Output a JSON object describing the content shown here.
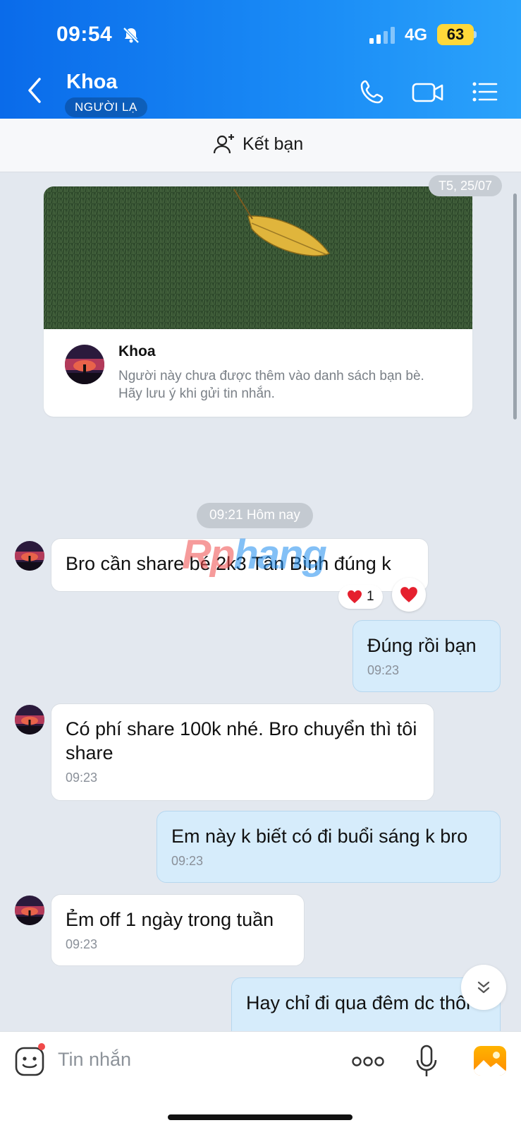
{
  "status_bar": {
    "time": "09:54",
    "network": "4G",
    "battery": "63"
  },
  "header": {
    "contact_name": "Khoa",
    "tag": "NGƯỜI LẠ"
  },
  "add_friend": {
    "label": "Kết bạn"
  },
  "chat": {
    "date_label": "T5, 25/07",
    "profile_card": {
      "name": "Khoa",
      "notice": "Người này chưa được thêm vào danh sách bạn bè. Hãy lưu ý khi gửi tin nhắn."
    },
    "time_divider": "09:21 Hôm nay",
    "watermark": {
      "part1": "Rp",
      "part2": "hang"
    },
    "messages": [
      {
        "dir": "in",
        "text": "Bro cần share bé 2k3 Tân Bình đúng k",
        "time": "",
        "reaction_count": "1"
      },
      {
        "dir": "out",
        "text": "Đúng rồi bạn",
        "time": "09:23"
      },
      {
        "dir": "in",
        "text": "Có phí share 100k nhé. Bro chuyển thì tôi share",
        "time": "09:23"
      },
      {
        "dir": "out",
        "text": "Em này k biết có đi buổi sáng k bro",
        "time": "09:23"
      },
      {
        "dir": "in",
        "text": "Ẻm off 1 ngày trong tuần",
        "time": "09:23"
      },
      {
        "dir": "out",
        "text": "Hay chỉ đi qua đêm dc thôi",
        "time": ""
      }
    ]
  },
  "input": {
    "placeholder": "Tin nhắn"
  },
  "icons": {
    "back": "chevron-left-icon",
    "call": "phone-icon",
    "video": "video-camera-icon",
    "menu": "list-icon",
    "add_friend": "add-user-icon",
    "sticker": "sticker-icon",
    "more": "more-dots-icon",
    "mic": "microphone-icon",
    "gallery": "image-gallery-icon",
    "scroll_down": "double-chevron-down-icon",
    "heart": "heart-icon"
  },
  "colors": {
    "header": "#0a6bea",
    "outgoing_bubble": "#d6ecfb",
    "chat_bg": "#e3e8ef",
    "battery": "#ffd83a",
    "heart": "#e5202e"
  }
}
